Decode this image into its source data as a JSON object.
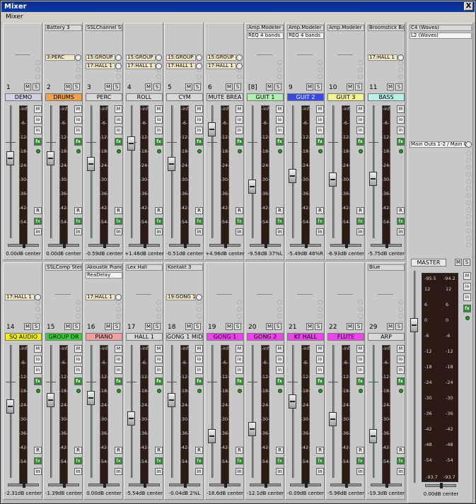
{
  "window": {
    "title": "Mixer",
    "close": "X"
  },
  "menu": {
    "mixer": "Mixer"
  },
  "labels": {
    "mute": "M",
    "solo": "S",
    "r": "R",
    "io": "io",
    "fx": "fx",
    "in": "in",
    "rd": "rd"
  },
  "top_strips": [
    {
      "num": "1",
      "name": "DEMO",
      "color": "#cfcfe6",
      "vol": "0.00dB center",
      "fader": 0.62,
      "fx": [],
      "sends": []
    },
    {
      "num": "2",
      "name": "DRUMS",
      "color": "#f2a04a",
      "vol": "0.00dB center",
      "fader": 0.62,
      "fx": [
        "Battery 3"
      ],
      "sends": [
        "3:PERC"
      ]
    },
    {
      "num": "3",
      "name": "PERC",
      "color": "#d8d8d8",
      "vol": "-0.59dB center",
      "fader": 0.57,
      "fx": [
        "SSLChannel Str"
      ],
      "sends": [
        "15:GROUP",
        "17:HALL 1"
      ]
    },
    {
      "num": "4",
      "name": "ROLL",
      "color": "#d8d8d8",
      "vol": "+1.46dB center",
      "fader": 0.74,
      "fx": [],
      "sends": [
        "15:GROUP",
        "17:HALL 1"
      ]
    },
    {
      "num": "5",
      "name": "CYM",
      "color": "#d8d8d8",
      "vol": "-0.51dB center",
      "fader": 0.57,
      "fx": [],
      "sends": [
        "15:GROUP",
        "17:HALL 1"
      ]
    },
    {
      "num": "6",
      "name": "MUTE BREA",
      "color": "#d8d8d8",
      "vol": "+4.96dB center",
      "fader": 0.86,
      "fx": [],
      "sends": [
        "15:GROUP",
        "17:HALL 1"
      ]
    },
    {
      "num": "[8]",
      "name": "GUIT 1",
      "color": "#aef0ae",
      "vol": "-9.58dB 37%L",
      "fader": 0.38,
      "fx": [
        "Amp.Modeler P",
        "REQ 4 bands"
      ],
      "sends": []
    },
    {
      "num": "9",
      "name": "GUIT 2",
      "color": "#3a4ae8",
      "vol": "-5.49dB 48%R",
      "fader": 0.47,
      "fx": [
        "Amp.Modeler P",
        "REQ 4 bands"
      ],
      "sends": []
    },
    {
      "num": "10",
      "name": "GUIT 3",
      "color": "#f2f28e",
      "vol": "-6.93dB center",
      "fader": 0.44,
      "fx": [
        "Amp.Modeler P"
      ],
      "sends": []
    },
    {
      "num": "11",
      "name": "BASS",
      "color": "#b6f2e8",
      "vol": "-5.75dB center",
      "fader": 0.45,
      "fx": [
        "Broomstick Bas"
      ],
      "sends": [
        "17:HALL 1"
      ]
    }
  ],
  "bottom_strips": [
    {
      "num": "14",
      "name": "SQ AUDIO",
      "color": "#f2f200",
      "vol": "-2.31dB center",
      "fader": 0.55,
      "fx": [],
      "sends": [
        "17:HALL 1"
      ]
    },
    {
      "num": "15",
      "name": "GROUP DR",
      "color": "#3ad03a",
      "vol": "-1.39dB center",
      "fader": 0.6,
      "fx": [
        "SSLComp Stere"
      ],
      "sends": []
    },
    {
      "num": "16",
      "name": "PIANO",
      "color": "#f0a0a0",
      "vol": "0.00dB center",
      "fader": 0.62,
      "fx": [
        "Akoustik Piano",
        "ReaDelay"
      ],
      "sends": [
        "17:HALL 1"
      ]
    },
    {
      "num": "17",
      "name": "HALL 1",
      "color": "#d8d8d8",
      "vol": "-5.54dB center",
      "fader": 0.45,
      "fx": [
        "Lex Hall"
      ],
      "sends": []
    },
    {
      "num": "18",
      "name": "GONG 1 MID",
      "color": "#d8d8d8",
      "vol": "-0.04dB 2%L",
      "fader": 0.6,
      "fx": [
        "Kontakt 3"
      ],
      "sends": [
        "19:GONG 1"
      ]
    },
    {
      "num": "19",
      "name": "GONG 1",
      "color": "#f040f0",
      "vol": "-18.6dB center",
      "fader": 0.3,
      "fx": [],
      "sends": []
    },
    {
      "num": "20",
      "name": "GONG 2",
      "color": "#f040f0",
      "vol": "-12.1dB center",
      "fader": 0.36,
      "fx": [],
      "sends": []
    },
    {
      "num": "21",
      "name": "KT HALL",
      "color": "#f040f0",
      "vol": "-0.09dB center",
      "fader": 0.59,
      "fx": [],
      "sends": []
    },
    {
      "num": "22",
      "name": "FLUTE",
      "color": "#f040f0",
      "vol": "-5.96dB center",
      "fader": 0.44,
      "fx": [],
      "sends": []
    },
    {
      "num": "29",
      "name": "ARP",
      "color": "#d8d8d8",
      "vol": "-19.3dB center",
      "fader": 0.3,
      "fx": [
        "Blue"
      ],
      "sends": []
    }
  ],
  "meter_scale": [
    "-inf",
    "-6-",
    "-12-",
    "-18-",
    "-24-",
    "-30-",
    "-36-",
    "-42-",
    "-54-"
  ],
  "meter_scale_top": [
    "103",
    "127",
    "98.6"
  ],
  "master": {
    "fx": [
      "C4 (Waves)",
      "L2 (Waves)"
    ],
    "output": "Main Outs 1-2 / Main Ou",
    "name": "MASTER",
    "peak_l": "-95.5",
    "peak_r": "-94.2",
    "bottom_l": "-93.7",
    "bottom_r": "-93.7",
    "vol": "0.00dB center",
    "scale": [
      "12",
      "6",
      "0",
      "-6",
      "-12",
      "-18",
      "-24",
      "-30",
      "-36",
      "-42",
      "-48",
      "-54"
    ]
  }
}
